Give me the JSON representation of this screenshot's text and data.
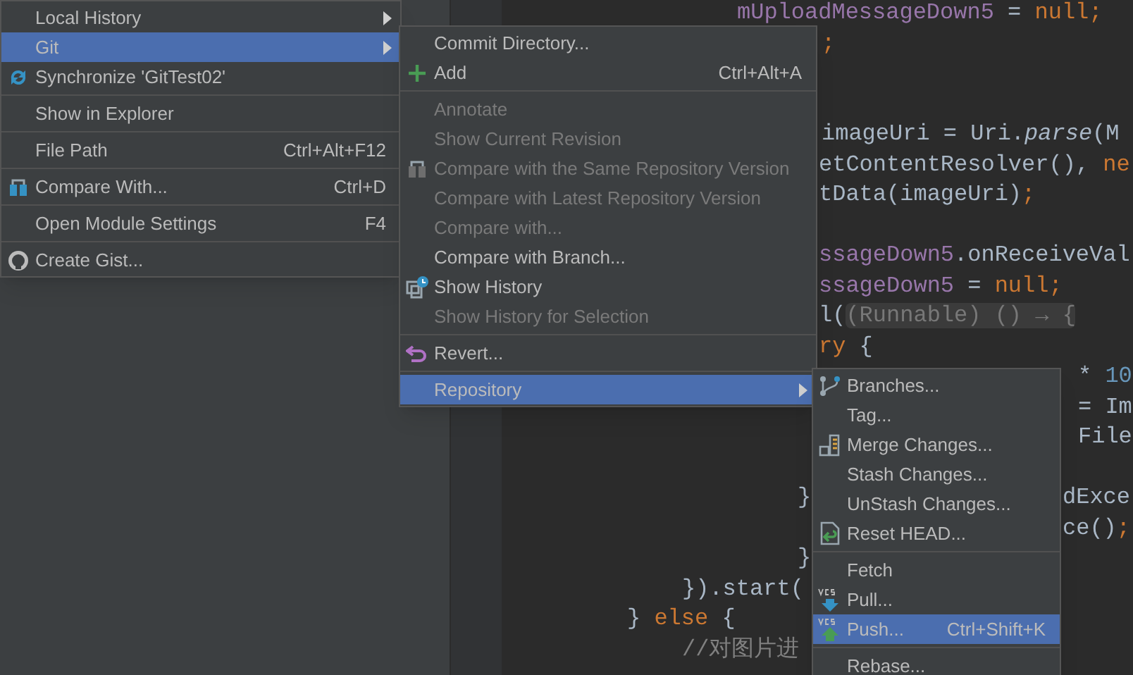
{
  "editor": {
    "lines": [
      {
        "runs": [
          [
            {
              "text": "mUploadMessageDown5",
              "kind": "field"
            },
            {
              "text": " = ",
              "kind": "plain"
            },
            {
              "text": "null;",
              "kind": "keyword"
            }
          ]
        ]
      },
      {
        "runs": [
          [
            {
              "text": ";",
              "kind": "keyword"
            }
          ]
        ]
      },
      {
        "runs": [
          [
            {
              "text": "imageUri = Uri.",
              "kind": "plain"
            },
            {
              "text": "parse",
              "kind": "method"
            },
            {
              "text": "(M",
              "kind": "plain"
            }
          ]
        ]
      },
      {
        "runs": [
          [
            {
              "text": "etContentResolver(), ",
              "kind": "plain"
            },
            {
              "text": "ne",
              "kind": "keyword"
            }
          ]
        ]
      },
      {
        "runs": [
          [
            {
              "text": "tData(imageUri)",
              "kind": "plain"
            },
            {
              "text": ";",
              "kind": "keyword"
            }
          ]
        ]
      },
      {
        "runs": [
          [
            {
              "text": "ssageDown5",
              "kind": "field"
            },
            {
              "text": ".onReceiveVal",
              "kind": "plain"
            }
          ]
        ]
      },
      {
        "runs": [
          [
            {
              "text": "ssageDown5",
              "kind": "field"
            },
            {
              "text": " = ",
              "kind": "plain"
            },
            {
              "text": "null;",
              "kind": "keyword"
            }
          ]
        ]
      },
      {
        "runs": [
          [
            {
              "text": "l(",
              "kind": "plain"
            },
            {
              "text": "(Runnable) () → {",
              "kind": "hint"
            }
          ]
        ]
      },
      {
        "runs": [
          [
            {
              "text": "ry",
              "kind": "keyword"
            },
            {
              "text": " {",
              "kind": "plain"
            }
          ]
        ]
      },
      {
        "runs": [
          [
            {
              "text": "* ",
              "kind": "plain"
            },
            {
              "text": "10",
              "kind": "number"
            }
          ]
        ]
      },
      {
        "runs": [
          [
            {
              "text": "= Im",
              "kind": "plain"
            }
          ]
        ]
      },
      {
        "runs": [
          [
            {
              "text": "File",
              "kind": "plain"
            }
          ]
        ]
      },
      {
        "runs": [
          [
            {
              "text": "}",
              "kind": "plain"
            }
          ],
          [
            {
              "text": "dExce",
              "kind": "plain"
            }
          ]
        ]
      },
      {
        "runs": [
          [
            {
              "text": "ce()",
              "kind": "plain"
            },
            {
              "text": ";",
              "kind": "keyword"
            }
          ]
        ]
      },
      {
        "runs": [
          [
            {
              "text": "}",
              "kind": "plain"
            }
          ]
        ]
      },
      {
        "runs": [
          [
            {
              "text": "}).start(",
              "kind": "plain"
            }
          ]
        ]
      },
      {
        "runs": [
          [
            {
              "text": "} ",
              "kind": "plain"
            },
            {
              "text": "else",
              "kind": "keyword"
            },
            {
              "text": " {",
              "kind": "plain"
            }
          ]
        ]
      },
      {
        "runs": [
          [
            {
              "text": "//对图片进",
              "kind": "comment"
            }
          ]
        ]
      }
    ]
  },
  "menus": [
    {
      "groups": [
        [
          {
            "label": "Local History",
            "submenu": true,
            "disabled": false,
            "selected": false
          },
          {
            "label": "Git",
            "submenu": true,
            "disabled": false,
            "selected": true
          },
          {
            "label": "Synchronize 'GitTest02'",
            "submenu": false,
            "disabled": false,
            "selected": false
          }
        ],
        [
          {
            "label": "Show in Explorer",
            "submenu": false,
            "disabled": false,
            "selected": false
          }
        ],
        [
          {
            "label": "File Path",
            "shortcut": "Ctrl+Alt+F12",
            "submenu": false,
            "disabled": false,
            "selected": false
          }
        ],
        [
          {
            "label": "Compare With...",
            "shortcut": "Ctrl+D",
            "submenu": false,
            "disabled": false,
            "selected": false
          }
        ],
        [
          {
            "label": "Open Module Settings",
            "shortcut": "F4",
            "submenu": false,
            "disabled": false,
            "selected": false
          }
        ],
        [
          {
            "label": "Create Gist...",
            "submenu": false,
            "disabled": false,
            "selected": false
          }
        ]
      ]
    },
    {
      "groups": [
        [
          {
            "label": "Commit Directory...",
            "submenu": false,
            "disabled": false,
            "selected": false
          },
          {
            "label": "Add",
            "shortcut": "Ctrl+Alt+A",
            "submenu": false,
            "disabled": false,
            "selected": false
          }
        ],
        [
          {
            "label": "Annotate",
            "submenu": false,
            "disabled": true,
            "selected": false
          },
          {
            "label": "Show Current Revision",
            "submenu": false,
            "disabled": true,
            "selected": false
          },
          {
            "label": "Compare with the Same Repository Version",
            "submenu": false,
            "disabled": true,
            "selected": false
          },
          {
            "label": "Compare with Latest Repository Version",
            "submenu": false,
            "disabled": true,
            "selected": false
          },
          {
            "label": "Compare with...",
            "submenu": false,
            "disabled": true,
            "selected": false
          },
          {
            "label": "Compare with Branch...",
            "submenu": false,
            "disabled": false,
            "selected": false
          },
          {
            "label": "Show History",
            "submenu": false,
            "disabled": false,
            "selected": false
          },
          {
            "label": "Show History for Selection",
            "submenu": false,
            "disabled": true,
            "selected": false
          }
        ],
        [
          {
            "label": "Revert...",
            "submenu": false,
            "disabled": false,
            "selected": false
          }
        ],
        [
          {
            "label": "Repository",
            "submenu": true,
            "disabled": false,
            "selected": true
          }
        ]
      ]
    },
    {
      "groups": [
        [
          {
            "label": "Branches...",
            "submenu": false,
            "disabled": false,
            "selected": false
          },
          {
            "label": "Tag...",
            "submenu": false,
            "disabled": false,
            "selected": false
          },
          {
            "label": "Merge Changes...",
            "submenu": false,
            "disabled": false,
            "selected": false
          },
          {
            "label": "Stash Changes...",
            "submenu": false,
            "disabled": false,
            "selected": false
          },
          {
            "label": "UnStash Changes...",
            "submenu": false,
            "disabled": false,
            "selected": false
          },
          {
            "label": "Reset HEAD...",
            "submenu": false,
            "disabled": false,
            "selected": false
          }
        ],
        [
          {
            "label": "Fetch",
            "submenu": false,
            "disabled": false,
            "selected": false
          },
          {
            "label": "Pull...",
            "submenu": false,
            "disabled": false,
            "selected": false
          },
          {
            "label": "Push...",
            "shortcut": "Ctrl+Shift+K",
            "submenu": false,
            "disabled": false,
            "selected": true
          }
        ],
        [
          {
            "label": "Rebase...",
            "submenu": false,
            "disabled": false,
            "selected": false
          }
        ]
      ]
    }
  ]
}
